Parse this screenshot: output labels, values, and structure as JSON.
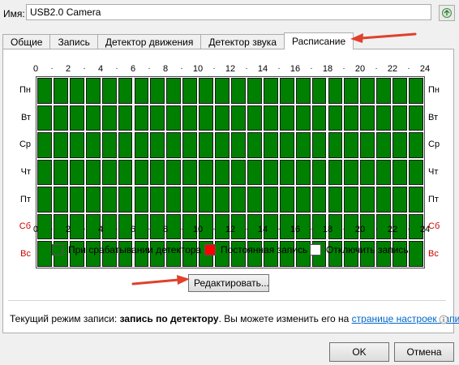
{
  "name_field": {
    "label": "Имя:",
    "value": "USB2.0 Camera"
  },
  "tabs": [
    {
      "label": "Общие",
      "active": false
    },
    {
      "label": "Запись",
      "active": false
    },
    {
      "label": "Детектор движения",
      "active": false
    },
    {
      "label": "Детектор звука",
      "active": false
    },
    {
      "label": "Расписание",
      "active": true
    }
  ],
  "schedule": {
    "hour_labels": [
      "0",
      "·",
      "2",
      "·",
      "4",
      "·",
      "6",
      "·",
      "8",
      "·",
      "10",
      "·",
      "12",
      "·",
      "14",
      "·",
      "16",
      "·",
      "18",
      "·",
      "20",
      "·",
      "22",
      "·",
      "24"
    ],
    "days": [
      {
        "label": "Пн",
        "weekend": false
      },
      {
        "label": "Вт",
        "weekend": false
      },
      {
        "label": "Ср",
        "weekend": false
      },
      {
        "label": "Чт",
        "weekend": false
      },
      {
        "label": "Пт",
        "weekend": false
      },
      {
        "label": "Сб",
        "weekend": true
      },
      {
        "label": "Вс",
        "weekend": true
      }
    ],
    "cell_mode": "detector"
  },
  "legend": [
    {
      "label": "При срабатывании детектора",
      "color": "#008000"
    },
    {
      "label": "Постоянная запись",
      "color": "#ff0000"
    },
    {
      "label": "Отключить запись",
      "color": "#ffffff"
    }
  ],
  "edit_button": "Редактировать...",
  "status": {
    "prefix": "Текущий режим записи: ",
    "mode": "запись по детектору",
    "middle": ". Вы можете изменить его на ",
    "link": "странице настроек записи"
  },
  "buttons": {
    "ok": "OK",
    "cancel": "Отмена"
  },
  "colors": {
    "detector": "#008000",
    "weekend_label": "#cc0000",
    "annotation_arrow": "#e0402c"
  }
}
